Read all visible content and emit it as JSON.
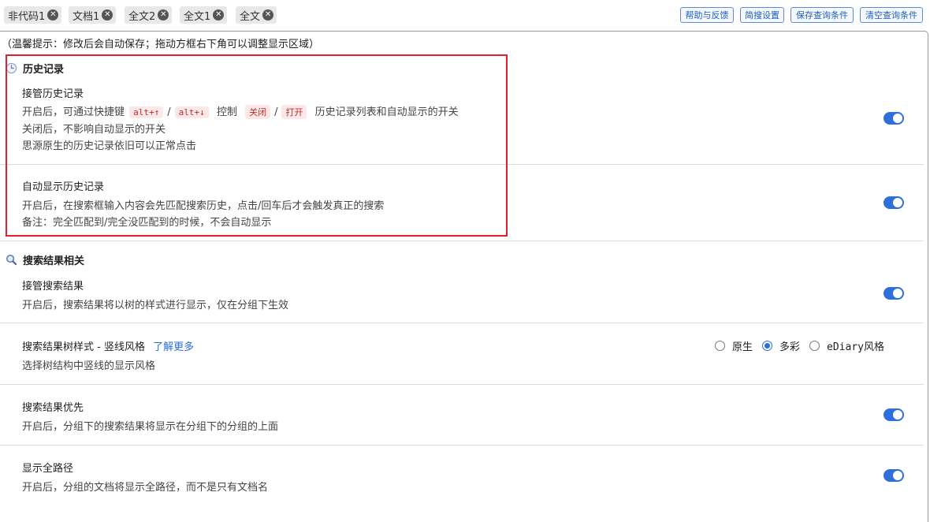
{
  "tags": [
    {
      "label": "非代码1"
    },
    {
      "label": "文档1"
    },
    {
      "label": "全文2"
    },
    {
      "label": "全文1"
    },
    {
      "label": "全文"
    }
  ],
  "actions": {
    "help": "帮助与反馈",
    "simple_settings": "简搜设置",
    "save_query": "保存查询条件",
    "clear_query": "清空查询条件"
  },
  "tip": "（温馨提示：修改后会自动保存；拖动方框右下角可以调整显示区域）",
  "history": {
    "title": "历史记录",
    "takeover": {
      "title": "接管历史记录",
      "line1_prefix": "开启后，可通过快捷键",
      "key_up": "alt+↑",
      "slash": "/",
      "key_down": "alt+↓",
      "line1_mid": "控制",
      "close": "关闭",
      "open": "打开",
      "line1_suffix": "历史记录列表和自动显示的开关",
      "line2": "关闭后，不影响自动显示的开关",
      "line3": "思源原生的历史记录依旧可以正常点击",
      "enabled": true
    },
    "auto_show": {
      "title": "自动显示历史记录",
      "line1": "开启后，在搜索框输入内容会先匹配搜索历史，点击/回车后才会触发真正的搜索",
      "line2": "备注：完全匹配到/完全没匹配到的时候，不会自动显示",
      "enabled": true
    }
  },
  "search": {
    "title": "搜索结果相关",
    "takeover": {
      "title": "接管搜索结果",
      "desc": "开启后，搜索结果将以树的样式进行显示，仅在分组下生效",
      "enabled": true
    },
    "tree_style": {
      "title": "搜索结果树样式 - 竖线风格",
      "learn_more": "了解更多",
      "desc": "选择树结构中竖线的显示风格",
      "options": [
        "原生",
        "多彩",
        "eDiary风格"
      ],
      "selected": "多彩"
    },
    "priority": {
      "title": "搜索结果优先",
      "desc": "开启后，分组下的搜索结果将显示在分组下的分组的上面",
      "enabled": true
    },
    "full_path": {
      "title": "显示全路径",
      "desc": "开启后，分组的文档将显示全路径，而不是只有文档名",
      "enabled": true
    }
  },
  "colors": {
    "accent": "#2f6fdc",
    "highlight_border": "#e0202a",
    "kbd_bg": "#fbe9e9",
    "kbd_text": "#c02b2b"
  }
}
